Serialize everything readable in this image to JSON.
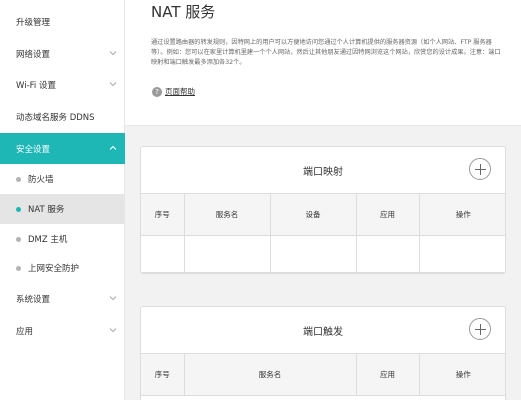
{
  "sidebar": {
    "items": [
      {
        "label": "升级管理"
      },
      {
        "label": "网络设置"
      },
      {
        "label": "Wi-Fi 设置"
      },
      {
        "label": "动态域名服务 DDNS"
      },
      {
        "label": "安全设置"
      },
      {
        "label": "系统设置"
      },
      {
        "label": "应用"
      }
    ],
    "security_sub": [
      {
        "label": "防火墙"
      },
      {
        "label": "NAT 服务"
      },
      {
        "label": "DMZ 主机"
      },
      {
        "label": "上网安全防护"
      }
    ]
  },
  "main": {
    "title": "NAT 服务",
    "description": "通过设置路由器的转发规则，因特网上的用户可以方便地访问您通过个人计算机提供的服务器资源（如个人网站、FTP 服务器等）。例如：您可以在家里计算机里建一个个人网站，然后让其他朋友通过因特网浏览这个网站，欣赏您的设计成果。注意：端口映射和端口触发最多添加各32个。",
    "help_label": "页面帮助",
    "help_icon": "?",
    "port_mapping": {
      "title": "端口映射",
      "columns": [
        "序号",
        "服务名",
        "设备",
        "应用",
        "操作"
      ]
    },
    "port_trigger": {
      "title": "端口触发",
      "columns": [
        "序号",
        "服务名",
        "应用",
        "操作"
      ]
    }
  },
  "colors": {
    "accent": "#1fb6b6",
    "selected_bg": "#e5e5e5"
  }
}
